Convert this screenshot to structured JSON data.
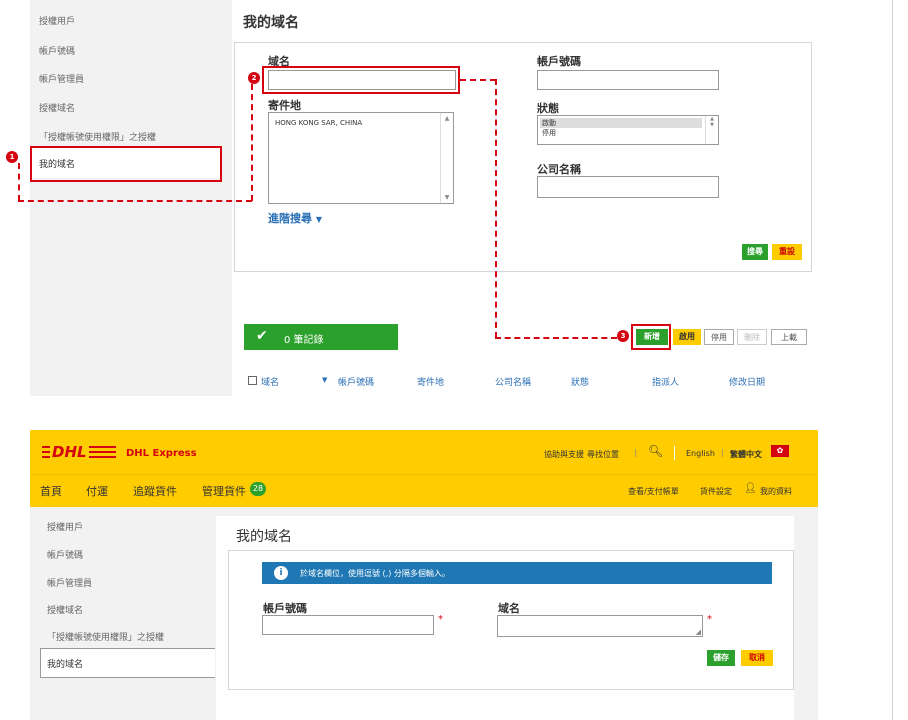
{
  "colors": {
    "dhl_yellow": "#ffcc00",
    "dhl_red": "#d40511",
    "green": "#2ca02c",
    "info_blue": "#1f78b4",
    "link_blue": "#2a6fb5"
  },
  "top": {
    "sidebar": [
      "授權用戶",
      "帳戶號碼",
      "帳戶管理員",
      "授權域名",
      "「授權帳號使用權限」之授權",
      "我的域名"
    ],
    "page_title": "我的域名",
    "form": {
      "domain_label": "域名",
      "account_label": "帳戶號碼",
      "origin_label": "寄件地",
      "origin_option": "HONG KONG SAR, CHINA",
      "status_label": "狀態",
      "status_options": [
        "啟動",
        "停用"
      ],
      "company_label": "公司名稱",
      "advanced_search": "進階搜尋",
      "search_button": "搜尋",
      "reset_button": "重設"
    },
    "result_count": "0 筆記錄",
    "actions": {
      "new": "新增",
      "enable": "啟用",
      "disable": "停用",
      "delete": "刪除",
      "upload": "上載"
    },
    "columns": [
      "域名",
      "帳戶號碼",
      "寄件地",
      "公司名稱",
      "狀態",
      "指派人",
      "修改日期"
    ],
    "markers": [
      "1",
      "2",
      "3"
    ]
  },
  "bottom": {
    "brand": "DHL Express",
    "logo_text": "DHL",
    "top_links": {
      "help": "協助與支援",
      "find": "尋找位置",
      "english": "English",
      "chinese": "繁體中文"
    },
    "nav": {
      "home": "首頁",
      "pay": "付運",
      "manage": "追蹤貨件",
      "manage2": "管理貨件",
      "badge": "28"
    },
    "nav_right": {
      "billing": "查看/支付帳單",
      "settings": "貨件設定",
      "profile": "我的資料"
    },
    "sidebar": [
      "授權用戶",
      "帳戶號碼",
      "帳戶管理員",
      "授權域名",
      "「授權帳號使用權限」之授權",
      "我的域名"
    ],
    "page_title": "我的域名",
    "info_text": "於域名欄位，使用逗號 (,) 分隔多個輸入。",
    "account_label": "帳戶號碼",
    "domain_label": "域名",
    "required": "*",
    "save_button": "儲存",
    "cancel_button": "取消"
  }
}
